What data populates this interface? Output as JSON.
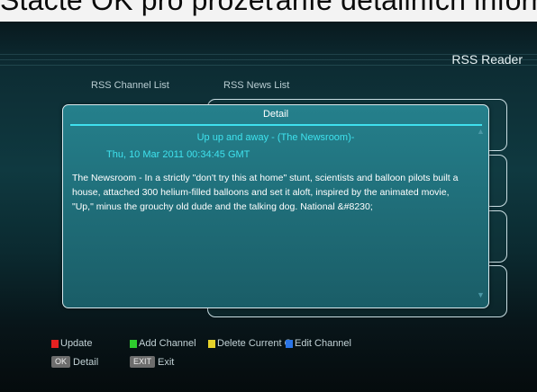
{
  "overlay_caption": "Stačte OK pro prozeťaníe detailních informací",
  "app_title": "RSS Reader",
  "headers": {
    "channel_list": "RSS Channel List",
    "news_list": "RSS News List"
  },
  "detail": {
    "title": "Detail",
    "news_title": "Up up and away -   (The Newsroom)-",
    "date": "Thu, 10 Mar 2011 00:34:45 GMT",
    "body": "The Newsroom - In a strictly \"don't try this at home\" stunt, scientists and balloon pilots built a house, attached 300 helium-filled balloons and set it aloft, inspired by the animated movie, \"Up,\" minus the grouchy old dude and the talking dog. National &#8230;"
  },
  "footer": {
    "update": "Update",
    "add_channel": "Add Channel",
    "delete_current": "Delete Current C",
    "edit_channel": "Edit Channel",
    "ok_key": "OK",
    "ok_label": "Detail",
    "exit_key": "EXIT",
    "exit_label": "Exit"
  },
  "colors": {
    "red_key": "#e42121",
    "green_key": "#2ecb2e",
    "yellow_key": "#e6d22a",
    "blue_key": "#2a74e6",
    "accent": "#3fe2ee"
  },
  "icons": {
    "scroll_up": "up-arrow-icon",
    "scroll_down": "down-arrow-icon"
  }
}
